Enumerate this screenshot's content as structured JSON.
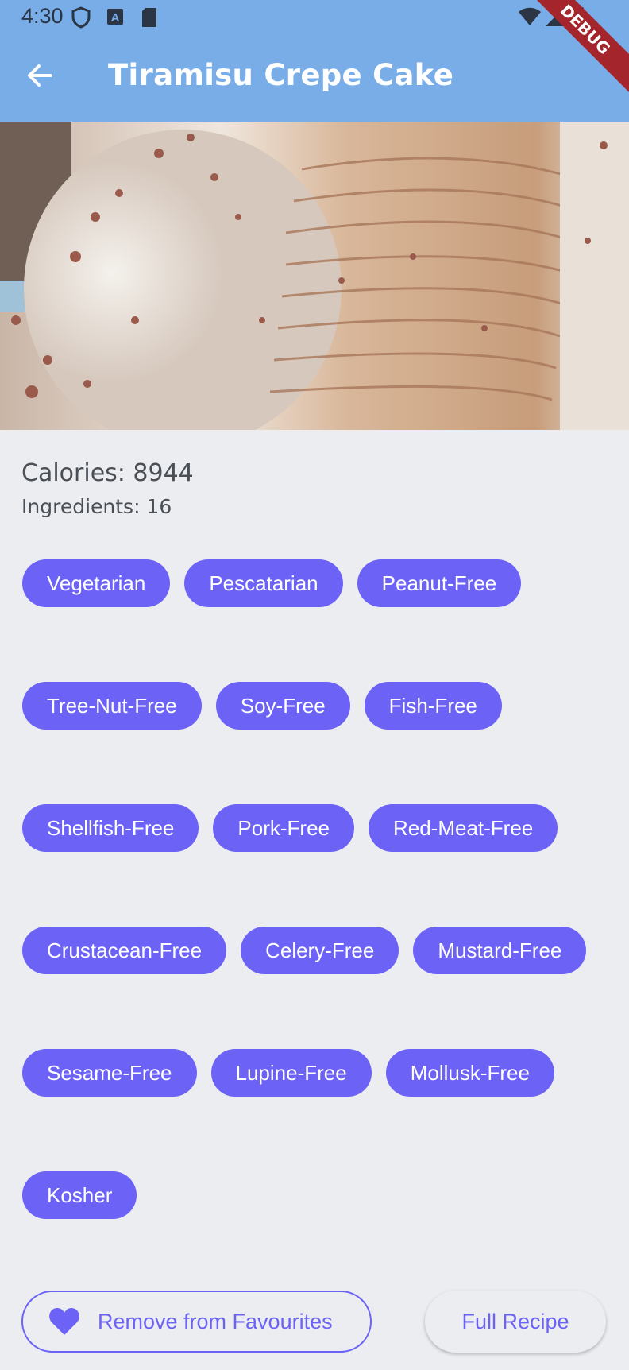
{
  "status_bar": {
    "time": "4:30"
  },
  "app_bar": {
    "title": "Tiramisu Crepe Cake",
    "debug_label": "DEBUG"
  },
  "info": {
    "calories": "Calories: 8944",
    "ingredients": "Ingredients: 16"
  },
  "tags": [
    "Vegetarian",
    "Pescatarian",
    "Peanut-Free",
    "Tree-Nut-Free",
    "Soy-Free",
    "Fish-Free",
    "Shellfish-Free",
    "Pork-Free",
    "Red-Meat-Free",
    "Crustacean-Free",
    "Celery-Free",
    "Mustard-Free",
    "Sesame-Free",
    "Lupine-Free",
    "Mollusk-Free",
    "Kosher"
  ],
  "actions": {
    "favourite_label": "Remove from Favourites",
    "recipe_label": "Full Recipe"
  },
  "colors": {
    "app_bar": "#79ADE8",
    "accent": "#6C63F6",
    "background": "#ECEDF0"
  }
}
